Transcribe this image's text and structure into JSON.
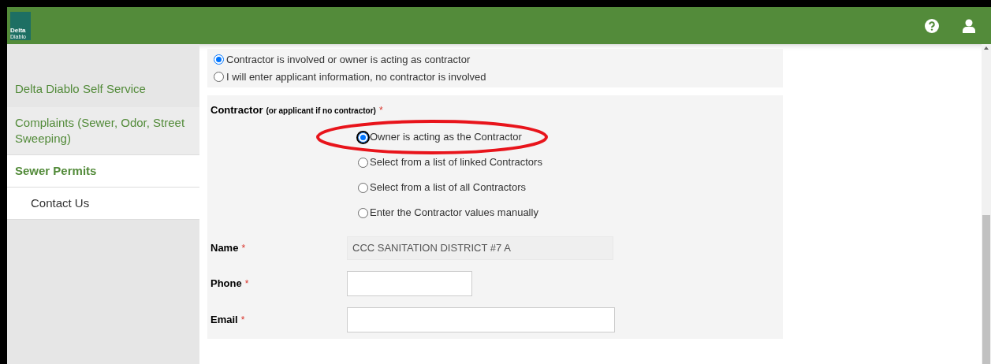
{
  "header": {
    "logo_text": [
      "Delta",
      "Diablo"
    ]
  },
  "sidebar": {
    "title": "Delta Diablo Self Service",
    "items": [
      {
        "label": "Complaints (Sewer, Odor, Street Sweeping)",
        "selected": false,
        "kind": "top"
      },
      {
        "label": "Sewer Permits",
        "selected": true,
        "kind": "top"
      },
      {
        "label": "Contact Us",
        "selected": false,
        "kind": "sub"
      }
    ]
  },
  "applicant_choice": [
    {
      "label": "Contractor is involved or owner is acting as contractor",
      "selected": true
    },
    {
      "label": "I will enter applicant information, no contractor is involved",
      "selected": false
    }
  ],
  "contractor": {
    "label": "Contractor",
    "hint": "(or applicant if no contractor)",
    "required": "*",
    "options": [
      {
        "label": "Owner is acting as the Contractor",
        "selected": true,
        "circled": true
      },
      {
        "label": "Select from a list of linked Contractors",
        "selected": false,
        "circled": false
      },
      {
        "label": "Select from a list of all Contractors",
        "selected": false,
        "circled": false
      },
      {
        "label": "Enter the Contractor values manually",
        "selected": false,
        "circled": false
      }
    ],
    "fields": [
      {
        "label": "Name",
        "required": "*",
        "value": "CCC SANITATION DISTRICT #7 A",
        "kind": "readonly"
      },
      {
        "label": "Phone",
        "required": "*",
        "kind": "short"
      },
      {
        "label": "Email",
        "required": "*",
        "kind": "long"
      }
    ]
  }
}
